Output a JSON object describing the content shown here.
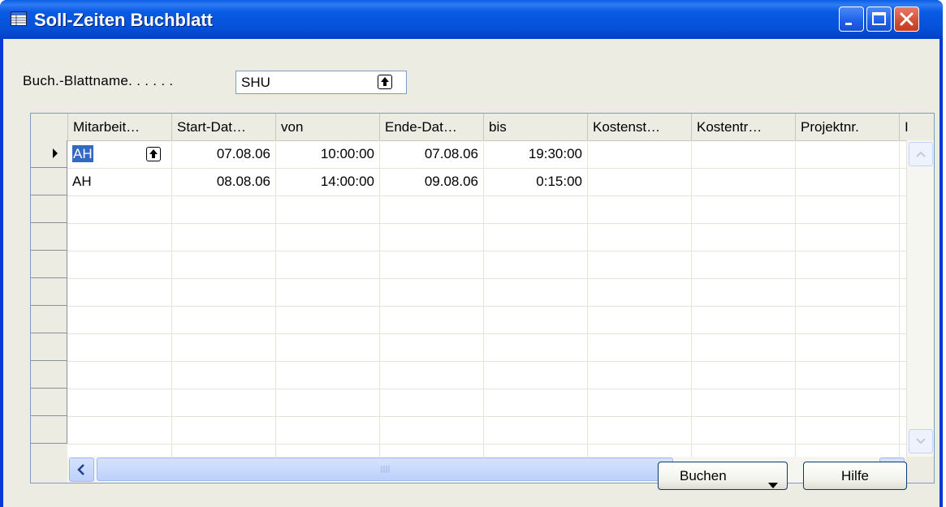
{
  "window": {
    "title": "Soll-Zeiten Buchblatt",
    "title_icon": "form-icon",
    "controls": [
      "minimize-icon",
      "maximize-icon",
      "close-icon"
    ]
  },
  "form": {
    "batch_label": "Buch.-Blattname. . . . . .",
    "batch_value": "SHU"
  },
  "table": {
    "columns": [
      "Mitarbeit…",
      "Start-Dat…",
      "von",
      "Ende-Dat…",
      "bis",
      "Kostenst…",
      "Kostentr…",
      "Projektnr.",
      "I"
    ],
    "rows": [
      [
        "AH",
        "07.08.06",
        "10:00:00",
        "07.08.06",
        "19:30:00",
        "",
        "",
        ""
      ],
      [
        "AH",
        "08.08.06",
        "14:00:00",
        "09.08.06",
        "0:15:00",
        "",
        "",
        ""
      ]
    ]
  },
  "buttons": {
    "post": "Buchen",
    "help": "Hilfe"
  },
  "colors": {
    "title_bar": "#0552d8",
    "selection": "#316ac5",
    "client": "#ecece3"
  }
}
